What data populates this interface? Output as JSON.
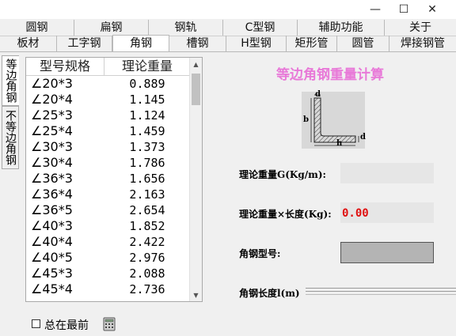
{
  "window": {
    "min_symbol": "—",
    "max_symbol": "☐",
    "close_symbol": "✕"
  },
  "tabs_top": [
    "圆钢",
    "扁钢",
    "钢轨",
    "C型钢",
    "辅助功能",
    "关于"
  ],
  "tabs_bottom": [
    "板材",
    "工字钢",
    "角钢",
    "槽钢",
    "H型钢",
    "矩形管",
    "圆管",
    "焊接钢管"
  ],
  "active_tab": "角钢",
  "side_tabs": [
    "等边角钢",
    "不等边角钢"
  ],
  "list": {
    "headers": [
      "型号规格",
      "理论重量"
    ],
    "rows": [
      {
        "spec": "∠20*3",
        "weight": "0.889"
      },
      {
        "spec": "∠20*4",
        "weight": "1.145"
      },
      {
        "spec": "∠25*3",
        "weight": "1.124"
      },
      {
        "spec": "∠25*4",
        "weight": "1.459"
      },
      {
        "spec": "∠30*3",
        "weight": "1.373"
      },
      {
        "spec": "∠30*4",
        "weight": "1.786"
      },
      {
        "spec": "∠36*3",
        "weight": "1.656"
      },
      {
        "spec": "∠36*4",
        "weight": "2.163"
      },
      {
        "spec": "∠36*5",
        "weight": "2.654"
      },
      {
        "spec": "∠40*3",
        "weight": "1.852"
      },
      {
        "spec": "∠40*4",
        "weight": "2.422"
      },
      {
        "spec": "∠40*5",
        "weight": "2.976"
      },
      {
        "spec": "∠45*3",
        "weight": "2.088"
      },
      {
        "spec": "∠45*4",
        "weight": "2.736"
      }
    ]
  },
  "calc": {
    "title": "等边角钢重量计算",
    "diagram_labels": {
      "d_top": "d",
      "b": "b",
      "d_right": "d",
      "h": "h"
    },
    "weight_per_m_label": "理论重量G(Kg/m):",
    "weight_per_m_value": "",
    "total_weight_label": "理论重量×长度(Kg):",
    "total_weight_value": "0.00",
    "model_label": "角钢型号:",
    "model_value": "",
    "length_label": "角钢长度l(m)"
  },
  "bottom": {
    "always_on_top_label": "总在最前",
    "calculator_icon": "calculator-icon"
  },
  "colors": {
    "title_pink": "#e879d8",
    "value_red": "#e01010"
  }
}
